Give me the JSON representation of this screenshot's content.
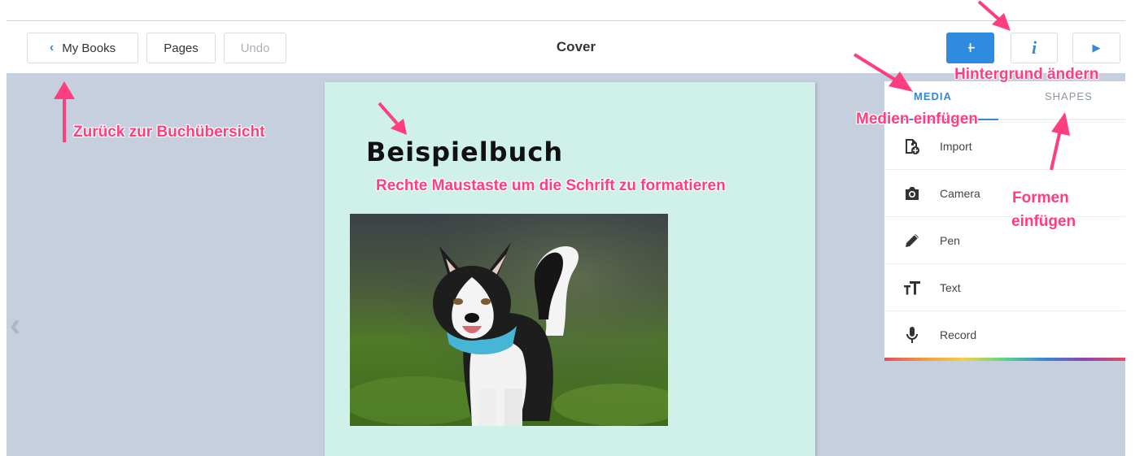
{
  "toolbar": {
    "back_label": "My Books",
    "pages_label": "Pages",
    "undo_label": "Undo",
    "title": "Cover",
    "add_symbol": "+",
    "info_symbol": "i",
    "play_symbol": "▶"
  },
  "page": {
    "book_title": "Beispielbuch"
  },
  "media_panel": {
    "tabs": [
      {
        "label": "MEDIA",
        "active": true
      },
      {
        "label": "SHAPES",
        "active": false
      }
    ],
    "items": [
      {
        "label": "Import",
        "icon": "file-import-icon"
      },
      {
        "label": "Camera",
        "icon": "camera-icon"
      },
      {
        "label": "Pen",
        "icon": "pen-icon"
      },
      {
        "label": "Text",
        "icon": "text-size-icon"
      },
      {
        "label": "Record",
        "icon": "microphone-icon"
      }
    ]
  },
  "annotations": {
    "back": "Zurück zur Buchübersicht",
    "format": "Rechte Maustaste um die Schrift zu formatieren",
    "background": "Hintergrund ändern",
    "media": "Medien einfügen",
    "shapes_line1": "Formen",
    "shapes_line2": "einfügen"
  },
  "colors": {
    "accent": "#2f8be0",
    "canvas": "#c5cfdd",
    "page": "#d0f1ea",
    "annotation": "#ff3e7f"
  }
}
